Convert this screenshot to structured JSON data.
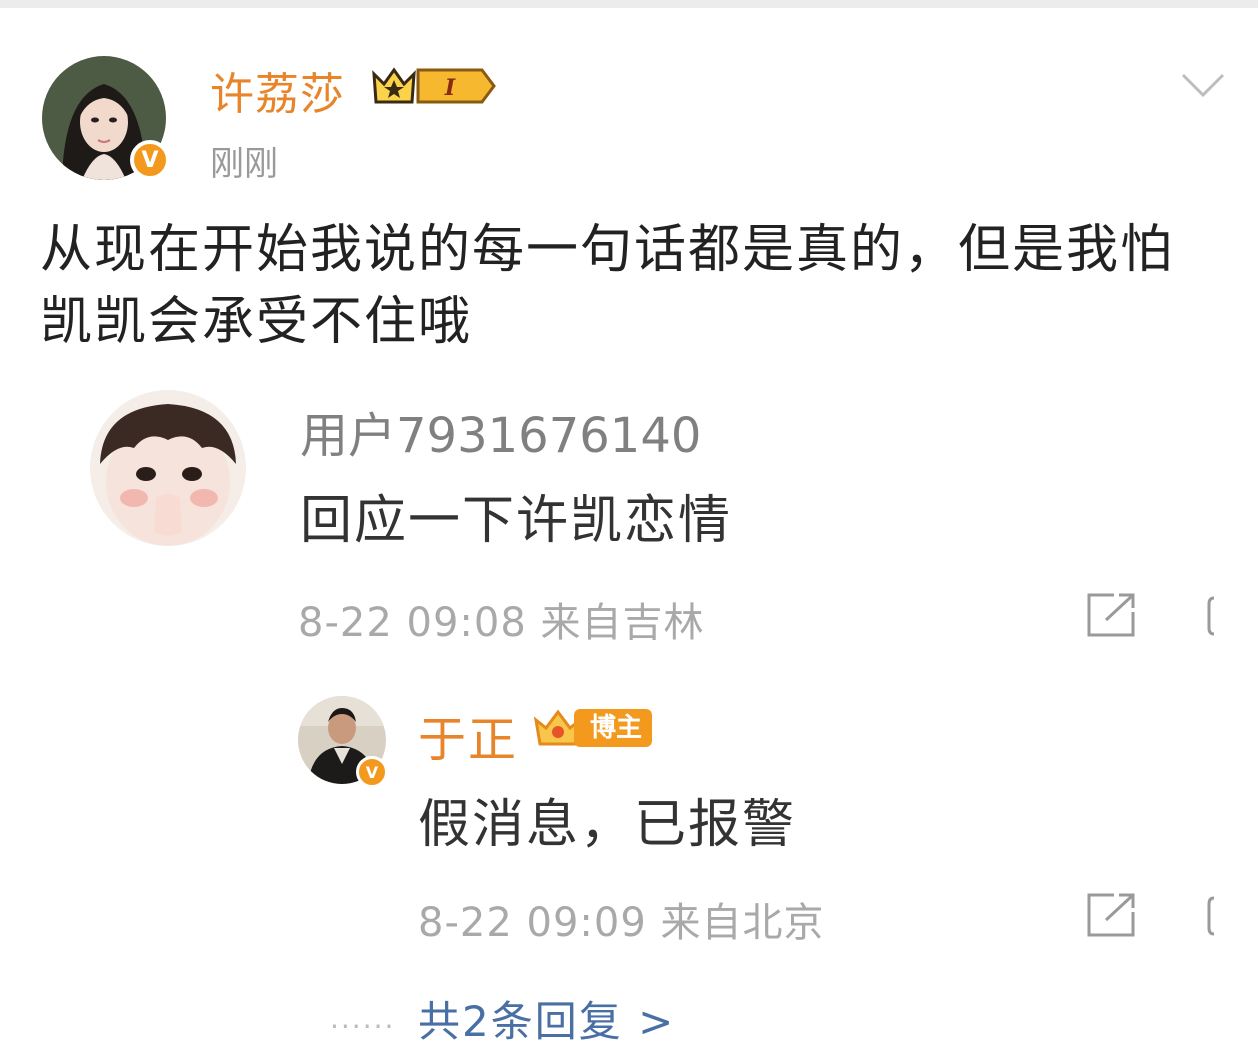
{
  "post": {
    "author": "许荔莎",
    "vip_level": "I",
    "time": "刚刚",
    "text": "从现在开始我说的每一句话都是真的，但是我怕凯凯会承受不住哦",
    "verified_mark": "V"
  },
  "comment": {
    "user": "用户7931676140",
    "text": "回应一下许凯恋情",
    "date": "8-22 09:08",
    "location": "来自吉林"
  },
  "reply": {
    "user": "于正",
    "badge": "博主",
    "verified_mark": "V",
    "text": "假消息，已报警",
    "date": "8-22 09:09",
    "location": "来自北京"
  },
  "more_replies": "共2条回复 >",
  "icons": {
    "chevron": "chevron-down-icon",
    "share": "share-icon",
    "crown": "crown-icon"
  },
  "colors": {
    "accent": "#e8842a",
    "verify": "#f39a1e",
    "link": "#4a6fa5"
  }
}
